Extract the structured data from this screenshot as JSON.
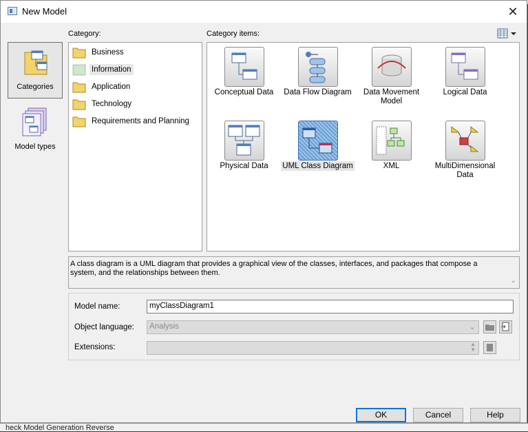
{
  "window": {
    "title": "New Model",
    "close_symbol": "✕"
  },
  "left_panel": {
    "items": [
      {
        "label": "Categories",
        "selected": true
      },
      {
        "label": "Model types",
        "selected": false
      }
    ]
  },
  "category": {
    "label": "Category:",
    "items": [
      {
        "label": "Business",
        "selected": false
      },
      {
        "label": "Information",
        "selected": true
      },
      {
        "label": "Application",
        "selected": false
      },
      {
        "label": "Technology",
        "selected": false
      },
      {
        "label": "Requirements and Planning",
        "selected": false
      }
    ]
  },
  "category_items": {
    "label": "Category items:",
    "items": [
      {
        "label": "Conceptual Data",
        "icon": "conceptual-data-icon"
      },
      {
        "label": "Data Flow Diagram",
        "icon": "data-flow-diagram-icon"
      },
      {
        "label": "Data Movement Model",
        "icon": "data-movement-model-icon"
      },
      {
        "label": "Logical Data",
        "icon": "logical-data-icon"
      },
      {
        "label": "Physical Data",
        "icon": "physical-data-icon"
      },
      {
        "label": "UML Class Diagram",
        "icon": "uml-class-diagram-icon",
        "selected": true
      },
      {
        "label": "XML",
        "icon": "xml-icon"
      },
      {
        "label": "MultiDimensional Data",
        "icon": "multidimensional-data-icon"
      }
    ]
  },
  "description": "A class diagram is a UML diagram that provides a graphical view of the classes, interfaces, and packages that compose a system, and the relationships between them.",
  "form": {
    "model_name_label": "Model name:",
    "model_name_value": "myClassDiagram1",
    "object_language_label": "Object language:",
    "object_language_value": "Analysis",
    "extensions_label": "Extensions:",
    "extensions_value": ""
  },
  "buttons": {
    "ok": "OK",
    "cancel": "Cancel",
    "help": "Help"
  },
  "background": {
    "status_text": "heck Model  Generation  Reverse"
  }
}
